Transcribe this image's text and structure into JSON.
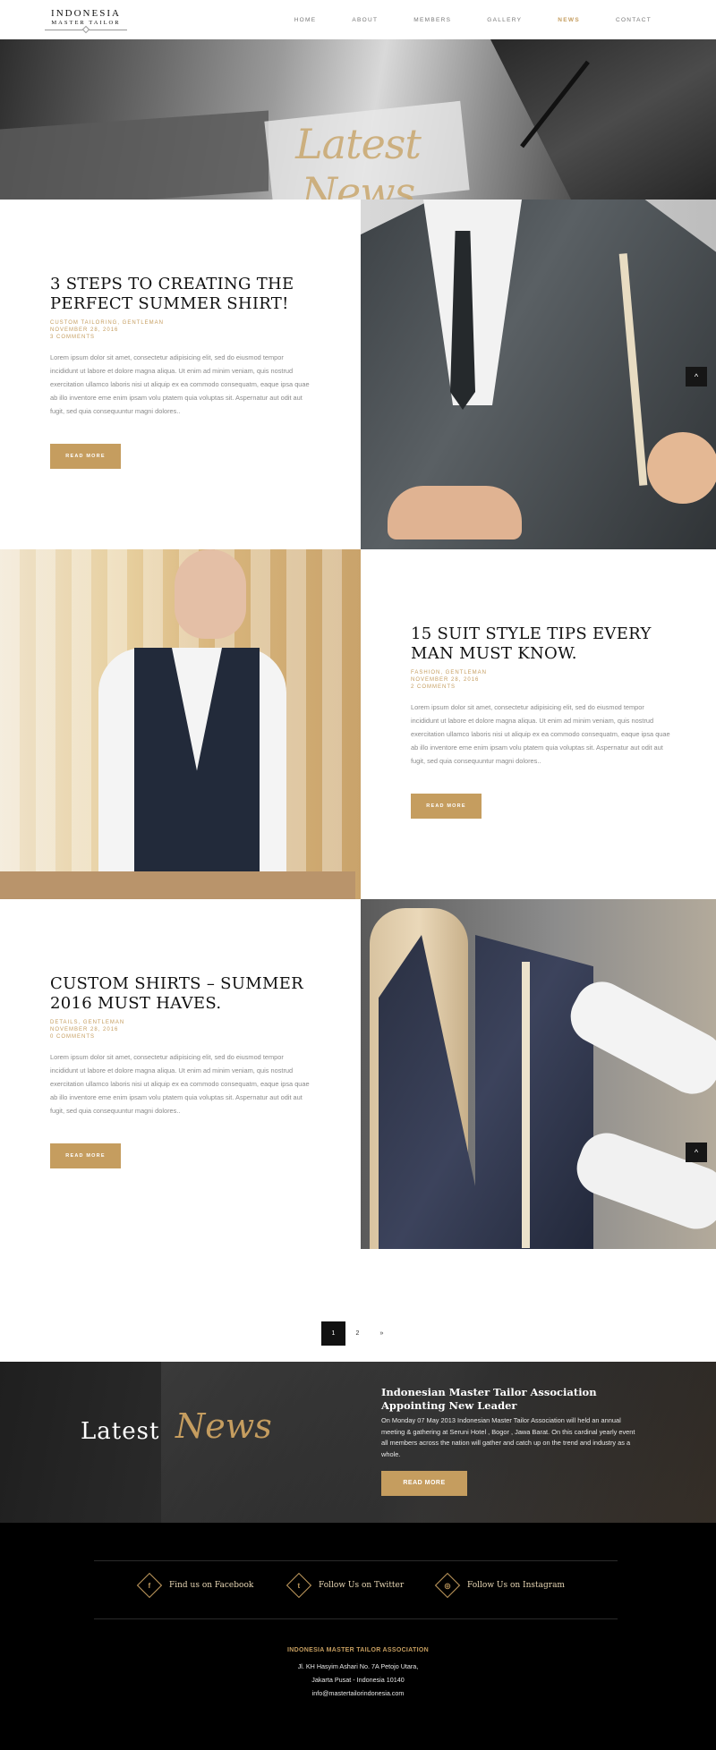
{
  "logo": {
    "top": "INDONESIA",
    "bottom": "MASTER TAILOR"
  },
  "nav": [
    {
      "label": "HOME"
    },
    {
      "label": "ABOUT"
    },
    {
      "label": "MEMBERS"
    },
    {
      "label": "GALLERY"
    },
    {
      "label": "NEWS",
      "active": true
    },
    {
      "label": "CONTACT"
    }
  ],
  "hero": {
    "title": "Latest News"
  },
  "articles": [
    {
      "title": "3 STEPS TO CREATING THE PERFECT SUMMER SHIRT!",
      "categories": "CUSTOM TAILORING, GENTLEMAN",
      "date": "NOVEMBER 28, 2016",
      "comments": "3 COMMENTS",
      "excerpt": "Lorem ipsum dolor sit amet, consectetur adipisicing elit, sed do eiusmod tempor incididunt ut labore et dolore magna aliqua. Ut enim ad minim veniam, quis nostrud exercitation ullamco laboris nisi ut aliquip ex ea commodo consequatm, eaque ipsa quae ab illo inventore eme enim ipsam volu ptatem quia voluptas sit. Aspernatur aut odit aut fugit, sed quia consequuntur magni dolores..",
      "button": "READ MORE"
    },
    {
      "title": "15 SUIT STYLE TIPS EVERY MAN MUST KNOW.",
      "categories": "FASHION, GENTLEMAN",
      "date": "NOVEMBER 28, 2016",
      "comments": "2 COMMENTS",
      "excerpt": "Lorem ipsum dolor sit amet, consectetur adipisicing elit, sed do eiusmod tempor incididunt ut labore et dolore magna aliqua. Ut enim ad minim veniam, quis nostrud exercitation ullamco laboris nisi ut aliquip ex ea commodo consequatm, eaque ipsa quae ab illo inventore eme enim ipsam volu ptatem quia voluptas sit. Aspernatur aut odit aut fugit, sed quia consequuntur magni dolores..",
      "button": "READ MORE"
    },
    {
      "title": "CUSTOM SHIRTS – SUMMER 2016 MUST HAVES.",
      "categories": "DETAILS, GENTLEMAN",
      "date": "NOVEMBER 28, 2016",
      "comments": "0 COMMENTS",
      "excerpt": "Lorem ipsum dolor sit amet, consectetur adipisicing elit, sed do eiusmod tempor incididunt ut labore et dolore magna aliqua. Ut enim ad minim veniam, quis nostrud exercitation ullamco laboris nisi ut aliquip ex ea commodo consequatm, eaque ipsa quae ab illo inventore eme enim ipsam volu ptatem quia voluptas sit. Aspernatur aut odit aut fugit, sed quia consequuntur magni dolores..",
      "button": "READ MORE"
    }
  ],
  "pagination": {
    "pages": [
      "1",
      "2"
    ],
    "next": "»",
    "current": "1"
  },
  "latest": {
    "title_word": "Latest",
    "title_script": "News",
    "heading": "Indonesian Master Tailor Association Appointing New Leader",
    "text": "On Monday 07 May 2013 Indonesian Master Tailor Association will held an annual meeting & gathering at Seruni Hotel , Bogor , Jawa Barat. On this cardinal yearly event all members across the nation will gather and catch up on the trend and industry as a whole.",
    "button": "READ MORE"
  },
  "social": [
    {
      "icon": "facebook-icon",
      "glyph": "f",
      "label": "Find us on Facebook"
    },
    {
      "icon": "twitter-icon",
      "glyph": "t",
      "label": "Follow Us on Twitter"
    },
    {
      "icon": "instagram-icon",
      "glyph": "◎",
      "label": "Follow Us on Instagram"
    }
  ],
  "footer": {
    "org": "INDONESIA MASTER TAILOR ASSOCIATION",
    "address1": "Jl. KH Hasyim Ashari No. 7A Petojo Utara,",
    "address2": "Jakarta Pusat - Indonesia 10140",
    "email": "info@mastertailorindonesia.com"
  },
  "colors": {
    "accent": "#c59d5f",
    "dark": "#111111"
  }
}
